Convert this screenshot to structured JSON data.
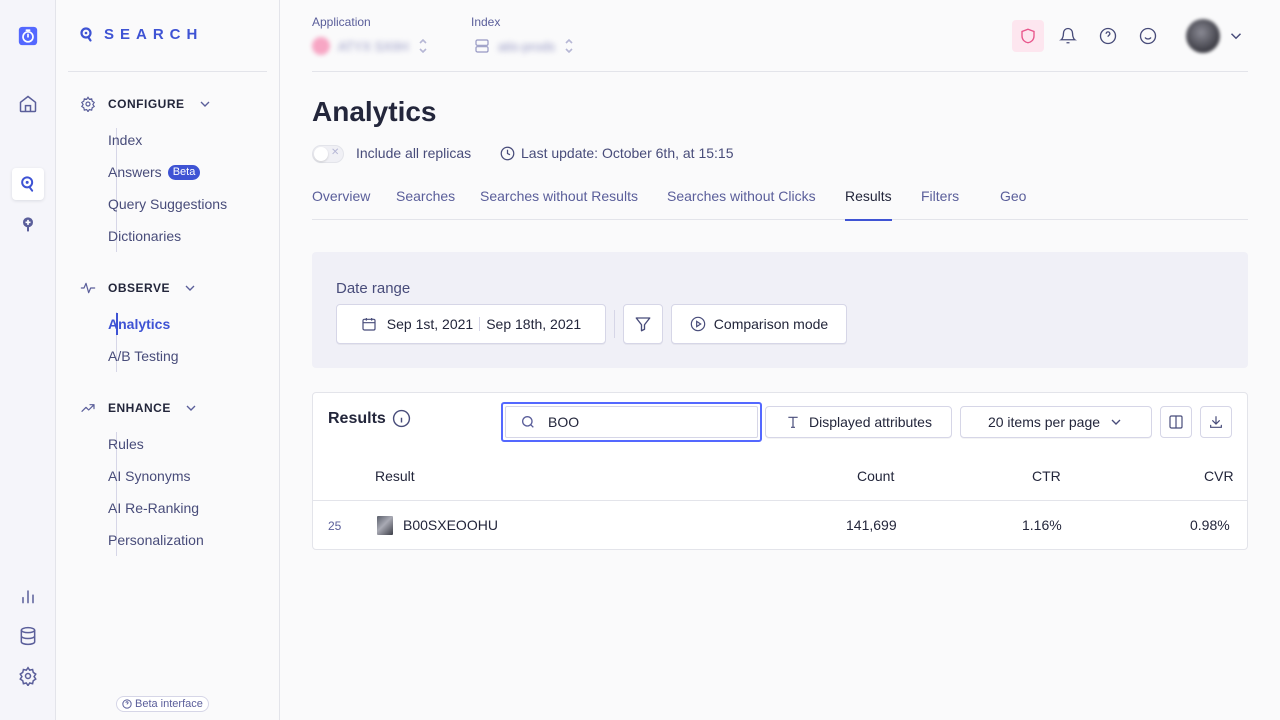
{
  "brand": {
    "name": "SEARCH"
  },
  "sidebar": {
    "configure": {
      "label": "CONFIGURE",
      "items": [
        "Index",
        "Answers",
        "Query Suggestions",
        "Dictionaries"
      ],
      "answers_badge": "Beta"
    },
    "observe": {
      "label": "OBSERVE",
      "items": [
        "Analytics",
        "A/B Testing"
      ],
      "active": "Analytics"
    },
    "enhance": {
      "label": "ENHANCE",
      "items": [
        "Rules",
        "AI Synonyms",
        "AI Re-Ranking",
        "Personalization"
      ]
    },
    "beta_interface": "Beta interface"
  },
  "topbar": {
    "application_label": "Application",
    "application_value": "ATYX SXIIH",
    "index_label": "Index",
    "index_value": "atis-prods"
  },
  "page": {
    "title": "Analytics",
    "include_replicas": "Include all replicas",
    "include_replicas_on": false,
    "last_update": "Last update: October 6th, at 15:15",
    "tabs": [
      "Overview",
      "Searches",
      "Searches without Results",
      "Searches without Clicks",
      "Results",
      "Filters",
      "Geo"
    ],
    "active_tab": "Results"
  },
  "date_range": {
    "label": "Date range",
    "start": "Sep 1st, 2021",
    "end": "Sep 18th, 2021",
    "comparison": "Comparison mode"
  },
  "results": {
    "title": "Results",
    "search_value": "BOO",
    "displayed_attributes": "Displayed attributes",
    "per_page": "20 items per page",
    "columns": [
      "Result",
      "Count",
      "CTR",
      "CVR"
    ],
    "rows": [
      {
        "rank": "25",
        "result": "B00SXEOOHU",
        "count": "141,699",
        "ctr": "1.16%",
        "cvr": "0.98%"
      }
    ]
  },
  "colors": {
    "accent": "#3e53d4",
    "focus": "#5468ff",
    "text": "#23263b"
  },
  "icons": [
    "timer-icon",
    "home-icon",
    "search-product-icon",
    "recommend-icon",
    "chart-icon",
    "database-icon",
    "gear-icon",
    "shield-icon",
    "bell-icon",
    "help-icon",
    "smiley-icon",
    "avatar",
    "calendar-icon",
    "filter-icon",
    "play-circle-icon",
    "info-icon",
    "search-icon",
    "text-icon",
    "columns-icon",
    "download-icon"
  ]
}
